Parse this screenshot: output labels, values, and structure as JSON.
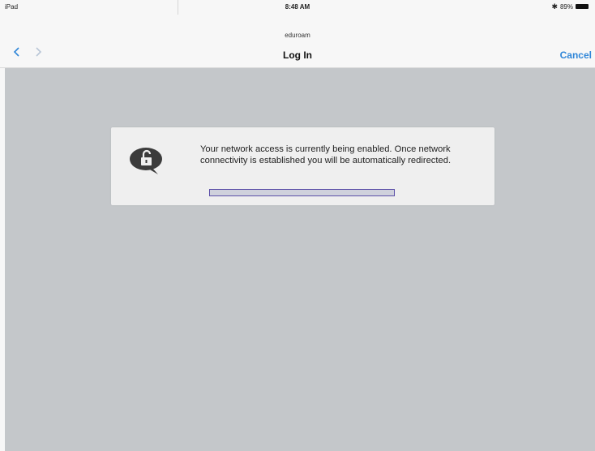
{
  "status_bar": {
    "device": "iPad",
    "time": "8:48 AM",
    "battery": "89%",
    "bluetooth_icon": "bluetooth-icon",
    "battery_icon": "battery-icon"
  },
  "nav": {
    "network": "eduroam",
    "title": "Log In",
    "cancel": "Cancel",
    "back_icon": "chevron-left-icon",
    "forward_icon": "chevron-right-icon",
    "accent": "#2f86d8"
  },
  "dialog": {
    "icon": "unlocked-lock-speech-bubble-icon",
    "message": "Your network access is currently being enabled. Once network connectivity is established you will be automatically redirected.",
    "progress": 1.0,
    "border_color": "#5b4fa8"
  },
  "background_color": "#c4c7ca"
}
